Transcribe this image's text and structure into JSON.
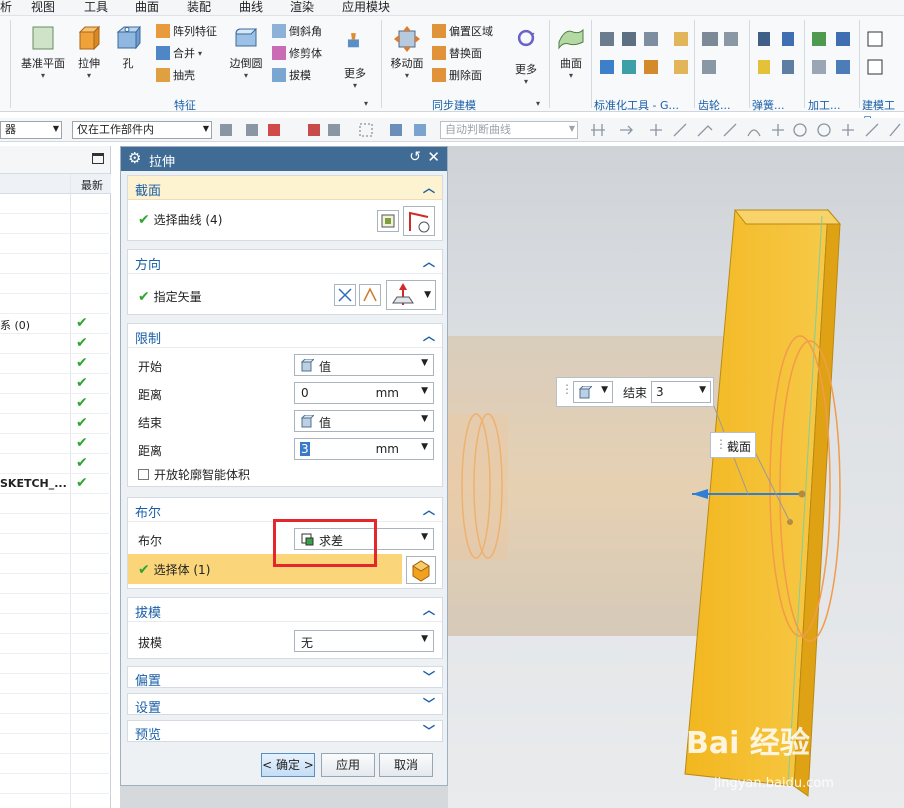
{
  "menu": [
    "析",
    "视图",
    "工具",
    "曲面",
    "装配",
    "曲线",
    "渲染",
    "应用模块"
  ],
  "ribbon": {
    "big_buttons": [
      {
        "label": "基准平面",
        "icon": "datum-plane-icon"
      },
      {
        "label": "拉伸",
        "icon": "extrude-icon"
      },
      {
        "label": "孔",
        "icon": "hole-icon"
      },
      {
        "label": "边倒圆",
        "icon": "edge-blend-icon"
      },
      {
        "label": "更多",
        "icon": "more-icon"
      },
      {
        "label": "移动面",
        "icon": "move-face-icon"
      },
      {
        "label": "更多",
        "icon": "more-icon"
      },
      {
        "label": "曲面",
        "icon": "surface-icon"
      }
    ],
    "small_buttons": [
      {
        "label": "阵列特征"
      },
      {
        "label": "合并"
      },
      {
        "label": "抽壳"
      },
      {
        "label": "倒斜角"
      },
      {
        "label": "修剪体"
      },
      {
        "label": "拔模"
      },
      {
        "label": "偏置区域"
      },
      {
        "label": "替换面"
      },
      {
        "label": "删除面"
      }
    ],
    "groups": [
      "特征",
      "同步建模",
      "标准化工具 - G...",
      "齿轮...",
      "弹簧...",
      "加工...",
      "建模工具 -"
    ]
  },
  "toolbar2": {
    "filter_combo": "器",
    "scope_combo": "仅在工作部件内",
    "curve_rule_combo": "自动判断曲线"
  },
  "navigator": {
    "column_latest": "最新",
    "rows": [
      {
        "label": "",
        "latest": false
      },
      {
        "label": "",
        "latest": false
      },
      {
        "label": "",
        "latest": false
      },
      {
        "label": "",
        "latest": false
      },
      {
        "label": "",
        "latest": false
      },
      {
        "label": "",
        "latest": false
      },
      {
        "label": "系 (0)",
        "latest": true
      },
      {
        "label": "",
        "latest": true
      },
      {
        "label": "",
        "latest": true
      },
      {
        "label": "",
        "latest": true
      },
      {
        "label": "",
        "latest": true
      },
      {
        "label": "",
        "latest": true
      },
      {
        "label": "",
        "latest": true
      },
      {
        "label": "",
        "latest": true
      },
      {
        "label": "SKETCH_...",
        "latest": true
      }
    ]
  },
  "dialog": {
    "title": "拉伸",
    "section": {
      "title": "截面",
      "select_curve": "选择曲线 (4)"
    },
    "direction": {
      "title": "方向",
      "specify_vector": "指定矢量"
    },
    "limits": {
      "title": "限制",
      "start_label": "开始",
      "start_value": "值",
      "distance_label": "距离",
      "start_distance": "0",
      "end_label": "结束",
      "end_value": "值",
      "end_distance": "3",
      "unit": "mm",
      "open_profile": "开放轮廓智能体积"
    },
    "boolean": {
      "title": "布尔",
      "label": "布尔",
      "value": "求差",
      "select_body": "选择体 (1)"
    },
    "draft": {
      "title": "拔模",
      "label": "拔模",
      "value": "无"
    },
    "offset_title": "偏置",
    "settings_title": "设置",
    "preview_title": "预览",
    "ok": "< 确定 >",
    "apply": "应用",
    "cancel": "取消"
  },
  "viewport": {
    "end_label": "结束",
    "end_value": "3",
    "section_tag": "截面",
    "watermark": "Bai 经验",
    "watermark_url": "jingyan.baidu.com"
  },
  "colors": {
    "accent": "#1a5fa8",
    "title_bar": "#3f6b94",
    "highlight": "#fbd57a",
    "body": "#f2b71f",
    "red_box": "#e5262d"
  }
}
